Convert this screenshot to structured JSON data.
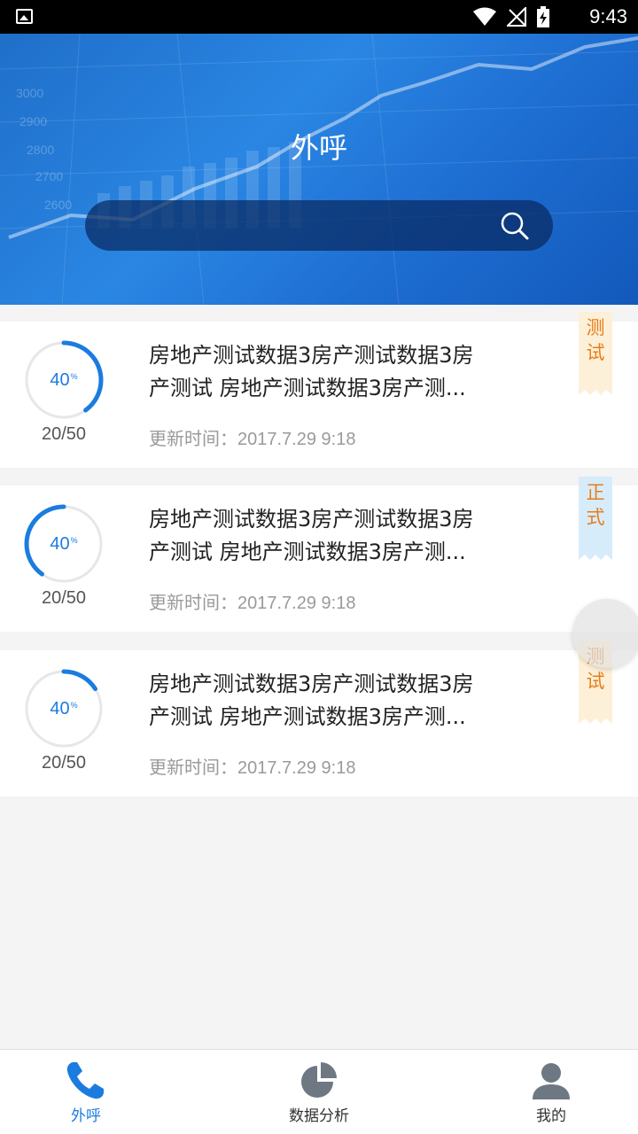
{
  "status_bar": {
    "time": "9:43"
  },
  "header": {
    "title": "外呼",
    "search": {
      "placeholder": ""
    }
  },
  "colors": {
    "accent": "#1b7ce0",
    "tag_test": "#e87d1a",
    "tag_formal": "#e87d1a",
    "tag_test_bg": "#fdf0d8",
    "tag_formal_bg": "#d7ecfb"
  },
  "cards": [
    {
      "progress_label": "40",
      "progress_unit": "%",
      "progress_fraction": 0.4,
      "count": "20/50",
      "title_line1": "房地产测试数据3房产测试数据3房",
      "title_line2": "产测试 房地产测试数据3房产测...",
      "updated_label": "更新时间：",
      "updated_value": "2017.7.29 9:18",
      "tag": "测试"
    },
    {
      "progress_label": "40",
      "progress_unit": "%",
      "progress_fraction": 0.4,
      "count": "20/50",
      "title_line1": "房地产测试数据3房产测试数据3房",
      "title_line2": "产测试 房地产测试数据3房产测...",
      "updated_label": "更新时间：",
      "updated_value": "2017.7.29 9:18",
      "tag": "正式"
    },
    {
      "progress_label": "40",
      "progress_unit": "%",
      "progress_fraction": 0.4,
      "count": "20/50",
      "title_line1": "房地产测试数据3房产测试数据3房",
      "title_line2": "产测试 房地产测试数据3房产测...",
      "updated_label": "更新时间：",
      "updated_value": "2017.7.29 9:18",
      "tag": "测试"
    }
  ],
  "tabs": [
    {
      "label": "外呼",
      "icon": "phone-icon",
      "active": true
    },
    {
      "label": "数据分析",
      "icon": "pie-chart-icon",
      "active": false
    },
    {
      "label": "我的",
      "icon": "user-icon",
      "active": false
    }
  ]
}
